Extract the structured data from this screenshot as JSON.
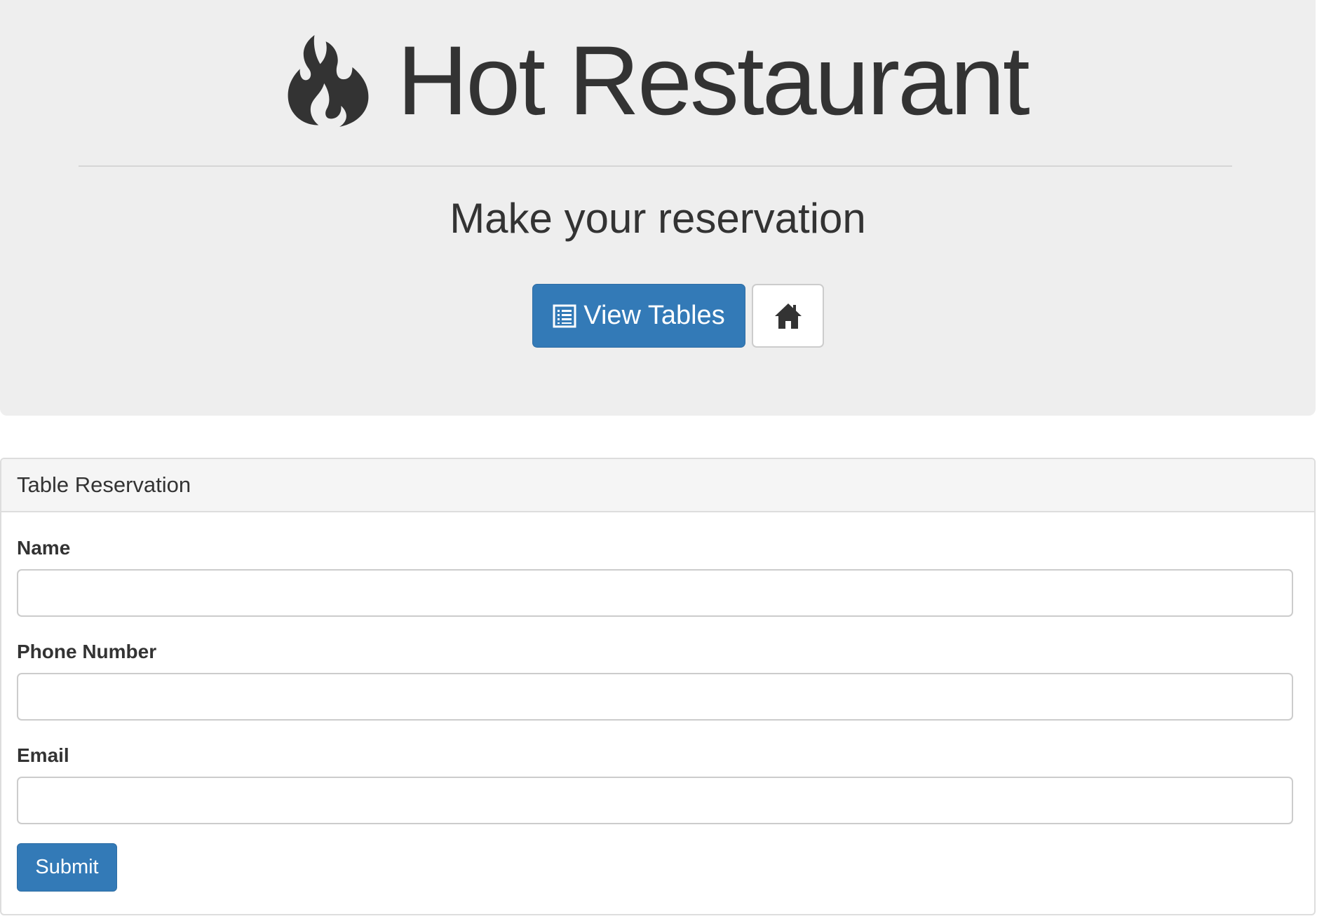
{
  "header": {
    "title": "Hot Restaurant",
    "subtitle": "Make your reservation",
    "view_tables_label": "View Tables"
  },
  "icons": {
    "brand": "fire-icon",
    "view_tables": "list-alt-icon",
    "home": "home-icon"
  },
  "colors": {
    "primary": "#337ab7",
    "jumbotron_bg": "#eeeeee",
    "text": "#333333"
  },
  "form": {
    "panel_title": "Table Reservation",
    "fields": [
      {
        "label": "Name",
        "value": "",
        "placeholder": ""
      },
      {
        "label": "Phone Number",
        "value": "",
        "placeholder": ""
      },
      {
        "label": "Email",
        "value": "",
        "placeholder": ""
      }
    ],
    "submit_label": "Submit"
  }
}
